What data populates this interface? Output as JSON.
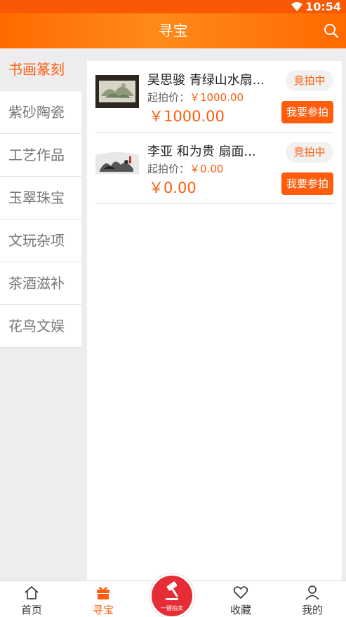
{
  "status_bar": {
    "time": "10:54"
  },
  "header": {
    "title": "寻宝"
  },
  "sidebar": {
    "items": [
      {
        "label": "书画篆刻"
      },
      {
        "label": "紫砂陶瓷"
      },
      {
        "label": "工艺作品"
      },
      {
        "label": "玉翠珠宝"
      },
      {
        "label": "文玩杂项"
      },
      {
        "label": "茶酒滋补"
      },
      {
        "label": "花鸟文娱"
      }
    ]
  },
  "lots": [
    {
      "name": "吴思骏  青绿山水扇...",
      "start_label": "起拍价：",
      "start_price": "￥1000.00",
      "price": "￥1000.00",
      "status": "竞拍中",
      "button": "我要参拍"
    },
    {
      "name": "李亚  和为贵  扇面...",
      "start_label": "起拍价：",
      "start_price": "￥0.00",
      "price": "￥0.00",
      "status": "竞拍中",
      "button": "我要参拍"
    }
  ],
  "tabbar": {
    "items": [
      {
        "label": "首页",
        "icon": "home-icon"
      },
      {
        "label": "寻宝",
        "icon": "gift-icon"
      },
      {
        "label": "收藏",
        "icon": "heart-icon"
      },
      {
        "label": "我的",
        "icon": "user-icon"
      }
    ],
    "center_label": "一键拍卖"
  },
  "colors": {
    "accent": "#ff5c0c",
    "header": "#ff7a10",
    "center_button": "#e62d35"
  }
}
